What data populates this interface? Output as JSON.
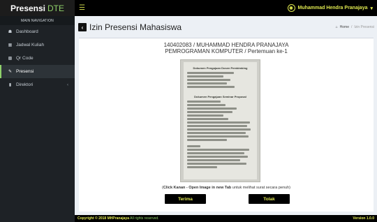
{
  "brand": {
    "name": "Presensi",
    "suffix": "DTE"
  },
  "navbar": {
    "menu_icon": "hamburger-icon",
    "user_icon": "user-circle-icon",
    "user_name": "Muhammad Hendra Pranajaya",
    "user_caret": "▾"
  },
  "sidebar": {
    "header": "MAIN NAVIGATION",
    "items": [
      {
        "label": "Dashboard",
        "icon": "dashboard-icon",
        "glyph": "☗"
      },
      {
        "label": "Jadwal Kuliah",
        "icon": "calendar-icon",
        "glyph": "▦"
      },
      {
        "label": "Qr Code",
        "icon": "qrcode-icon",
        "glyph": "▩"
      },
      {
        "label": "Presensi",
        "icon": "edit-icon",
        "glyph": "✎",
        "active": true
      },
      {
        "label": "Direktori",
        "icon": "book-icon",
        "glyph": "▮",
        "chevron": "‹"
      }
    ]
  },
  "content": {
    "title": "Izin Presensi Mahasiswa",
    "back_glyph": "‹",
    "breadcrumb": {
      "home_icon": "home-icon",
      "home_glyph": "⌂",
      "home": "Home",
      "sep": "/",
      "current": "Izin Presensi"
    },
    "student_line": "140402083 / MUHAMMAD HENDRA PRANAJAYA",
    "course_line": "PEMROGRAMAN KOMPUTER / Pertemuan ke-1",
    "hint_bold": "Click Kanan - Open Image in new Tab",
    "hint_rest": "untuk melihat surat secara penuh",
    "hint_open": "(",
    "hint_close": ")",
    "accept": "Terima",
    "reject": "Tolak",
    "scan": {
      "heading1": "Dokumen Pengajuan Dosen Pembimbing",
      "heading2": "Dokumen Pengajuan Seminar Proposal"
    }
  },
  "footer": {
    "copyright": "Copyright © 2018",
    "owner": "MHPranajaya",
    "rights": "All rights reserved.",
    "version": "Version 1.0.0"
  },
  "colors": {
    "accent_green": "#8fd16a",
    "accent_yellow": "#e2ea55",
    "sidebar_bg": "#1e2226",
    "header_bg": "#000000"
  }
}
